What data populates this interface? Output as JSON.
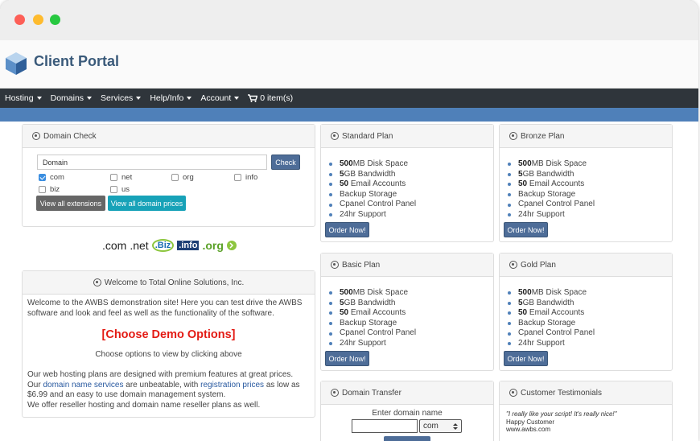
{
  "brand": "Client Portal",
  "nav": {
    "items": [
      "Hosting",
      "Domains",
      "Services",
      "Help/Info",
      "Account"
    ],
    "cart": "0 item(s)"
  },
  "domain_check": {
    "title": "Domain Check",
    "input_value": "Domain",
    "check_label": "Check",
    "extensions": [
      {
        "label": "com",
        "checked": true
      },
      {
        "label": "net",
        "checked": false
      },
      {
        "label": "org",
        "checked": false
      },
      {
        "label": "info",
        "checked": false
      },
      {
        "label": "biz",
        "checked": false
      },
      {
        "label": "us",
        "checked": false
      }
    ],
    "view_ext_label": "View all extensions",
    "view_prices_label": "View all domain prices"
  },
  "tld_logos": {
    "com": ".com",
    "net": ".net",
    "biz": ".Biz",
    "info": ".info",
    "org": ".org"
  },
  "welcome": {
    "title": "Welcome to Total Online Solutions, Inc.",
    "intro": "Welcome to the AWBS demonstration site! Here you can test drive the AWBS software and look and feel as well as the functionality of the software.",
    "demo": "[Choose Demo Options]",
    "choose": "Choose options to view by clicking above",
    "p1": "Our web hosting plans are designed with premium features at great prices.",
    "p2a": "Our ",
    "p2_link1": "domain name services",
    "p2b": " are unbeatable, with ",
    "p2_link2": "registration prices",
    "p2c": " as low as $6.99 and an easy to use domain management system.",
    "p3": "We offer reseller hosting and domain name reseller plans as well."
  },
  "plans": [
    {
      "title": "Standard Plan"
    },
    {
      "title": "Bronze Plan"
    },
    {
      "title": "Basic Plan"
    },
    {
      "title": "Gold Plan"
    }
  ],
  "plan_features": {
    "disk_bold": "500",
    "disk": "MB Disk Space",
    "bw_bold": "5",
    "bw": "GB Bandwidth",
    "email_bold": "50",
    "email": " Email Accounts",
    "backup": "Backup Storage",
    "cpanel": "Cpanel Control Panel",
    "support": "24hr Support"
  },
  "order_label": "Order Now!",
  "transfer": {
    "title": "Domain Transfer",
    "label": "Enter domain name",
    "tld_selected": "com"
  },
  "testimonials": {
    "title": "Customer Testimonials",
    "quote": "\"I really like your script! It's really nice!\"",
    "author": "Happy Customer",
    "site": "www.awbs.com"
  }
}
